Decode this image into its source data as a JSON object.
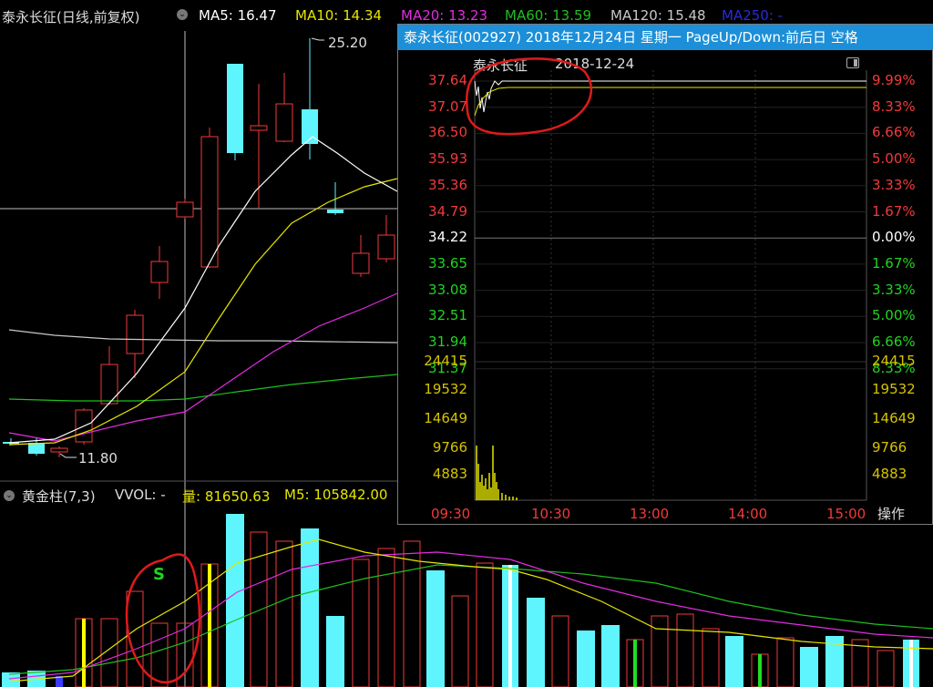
{
  "main_chart": {
    "stock_label": "泰永长征(日线,前复权)",
    "ma5": "MA5: 16.47",
    "ma10": "MA10: 14.34",
    "ma20": "MA20: 13.23",
    "ma60": "MA60: 13.59",
    "ma120": "MA120: 15.48",
    "ma250": "MA250: -",
    "high_price": "25.20",
    "low_price": "11.80",
    "colors": {
      "up": "#f23a3a",
      "down": "#5ff5ff",
      "ma5": "#ffffff",
      "ma10": "#e6e600",
      "ma20": "#e22ce2",
      "ma60": "#1fbf1f",
      "ma120": "#c8c8c8"
    }
  },
  "volume_panel": {
    "indicator": "黄金柱(7,3)",
    "vvol": "VVOL: -",
    "vol": "量: 81650.63",
    "m5": "M5: 105842.00",
    "signal": "S"
  },
  "popup": {
    "title": "泰永长征(002927) 2018年12月24日 星期一 PageUp/Down:前后日 空格",
    "stock_name": "泰永长征",
    "date": "2018-12-24",
    "left_prices": [
      "37.64",
      "37.07",
      "36.50",
      "35.93",
      "35.36",
      "34.79",
      "34.22",
      "33.65",
      "33.08",
      "32.51",
      "31.94",
      "31.37"
    ],
    "right_percents": [
      "9.99%",
      "8.33%",
      "6.66%",
      "5.00%",
      "3.33%",
      "1.67%",
      "0.00%",
      "1.67%",
      "3.33%",
      "5.00%",
      "6.66%",
      "8.33%"
    ],
    "volume_labels": [
      "24415",
      "19532",
      "14649",
      "9766",
      "4883"
    ],
    "time_labels": [
      "09:30",
      "10:30",
      "13:00",
      "14:00",
      "15:00"
    ],
    "operate_label": "操作"
  }
}
